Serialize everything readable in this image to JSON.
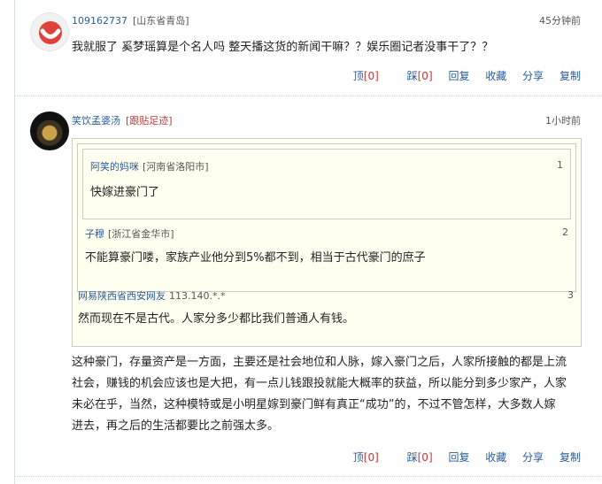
{
  "comments": [
    {
      "user": "109162737",
      "location": "[山东省青岛]",
      "time": "45分钟前",
      "text": "我就服了 奚梦瑶算是个名人吗 整天播这货的新闻干嘛？？娱乐圈记者没事干了？？",
      "actions": {
        "up_label": "顶",
        "up_count": "[0]",
        "down_label": "踩",
        "down_count": "[0]",
        "reply": "回复",
        "save": "收藏",
        "share": "分享",
        "copy": "复制"
      }
    },
    {
      "user": "笑饮孟婆汤",
      "follow": "[跟贴足迹]",
      "time": "1小时前",
      "quotes": [
        {
          "user": "阿笑的妈咪",
          "location": "[河南省洛阳市]",
          "floor": "1",
          "text": "快嫁进豪门了"
        },
        {
          "user": "子穆",
          "location": "[浙江省金华市]",
          "floor": "2",
          "text": "不能算豪门喽，家族产业他分到5%都不到，相当于古代豪门的庶子"
        },
        {
          "user": "网易陕西省西安网友",
          "location": "113.140.*.*",
          "floor": "3",
          "text": "然而现在不是古代。人家分多少都比我们普通人有钱。"
        }
      ],
      "text_lines": [
        "这种豪门，存量资产是一方面，主要还是社会地位和人脉，嫁入豪门之后，人家所接触的都是上流",
        "社会，赚钱的机会应该也是大把，有一点儿钱跟投就能大概率的获益，所以能分到多少家产，人家",
        "未必在乎，当然，这种模特或是小明星嫁到豪门鲜有真正“成功”的，不过不管怎样，大多数人嫁",
        "进去，再之后的生活都要比之前强太多。"
      ],
      "actions": {
        "up_label": "顶",
        "up_count": "[0]",
        "down_label": "踩",
        "down_count": "[0]",
        "reply": "回复",
        "save": "收藏",
        "share": "分享",
        "copy": "复制"
      }
    }
  ]
}
